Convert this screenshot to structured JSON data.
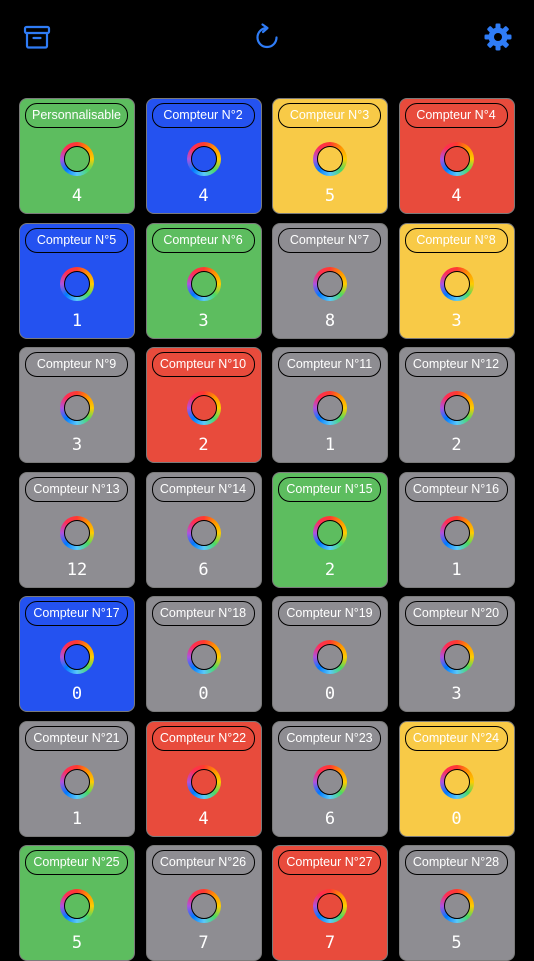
{
  "toolbar": {
    "archive_icon": "archive-box-icon",
    "refresh_icon": "refresh-icon",
    "settings_icon": "gear-icon",
    "accent_color": "#2f7cf6"
  },
  "palette": {
    "green": "#5dbd5f",
    "blue": "#2452f0",
    "yellow": "#f8ca47",
    "red": "#e84b3c",
    "gray": "#8e8d92"
  },
  "counters": [
    {
      "label": "Personnalisable",
      "color": "green",
      "value": "4"
    },
    {
      "label": "Compteur N°2",
      "color": "blue",
      "value": "4"
    },
    {
      "label": "Compteur N°3",
      "color": "yellow",
      "value": "5"
    },
    {
      "label": "Compteur N°4",
      "color": "red",
      "value": "4"
    },
    {
      "label": "Compteur N°5",
      "color": "blue",
      "value": "1"
    },
    {
      "label": "Compteur N°6",
      "color": "green",
      "value": "3"
    },
    {
      "label": "Compteur N°7",
      "color": "gray",
      "value": "8"
    },
    {
      "label": "Compteur N°8",
      "color": "yellow",
      "value": "3"
    },
    {
      "label": "Compteur N°9",
      "color": "gray",
      "value": "3"
    },
    {
      "label": "Compteur N°10",
      "color": "red",
      "value": "2"
    },
    {
      "label": "Compteur N°11",
      "color": "gray",
      "value": "1"
    },
    {
      "label": "Compteur N°12",
      "color": "gray",
      "value": "2"
    },
    {
      "label": "Compteur N°13",
      "color": "gray",
      "value": "12"
    },
    {
      "label": "Compteur N°14",
      "color": "gray",
      "value": "6"
    },
    {
      "label": "Compteur N°15",
      "color": "green",
      "value": "2"
    },
    {
      "label": "Compteur N°16",
      "color": "gray",
      "value": "1"
    },
    {
      "label": "Compteur N°17",
      "color": "blue",
      "value": "0"
    },
    {
      "label": "Compteur N°18",
      "color": "gray",
      "value": "0"
    },
    {
      "label": "Compteur N°19",
      "color": "gray",
      "value": "0"
    },
    {
      "label": "Compteur N°20",
      "color": "gray",
      "value": "3"
    },
    {
      "label": "Compteur N°21",
      "color": "gray",
      "value": "1"
    },
    {
      "label": "Compteur N°22",
      "color": "red",
      "value": "4"
    },
    {
      "label": "Compteur N°23",
      "color": "gray",
      "value": "6"
    },
    {
      "label": "Compteur N°24",
      "color": "yellow",
      "value": "0"
    },
    {
      "label": "Compteur N°25",
      "color": "green",
      "value": "5"
    },
    {
      "label": "Compteur N°26",
      "color": "gray",
      "value": "7"
    },
    {
      "label": "Compteur N°27",
      "color": "red",
      "value": "7"
    },
    {
      "label": "Compteur N°28",
      "color": "gray",
      "value": "5"
    }
  ]
}
